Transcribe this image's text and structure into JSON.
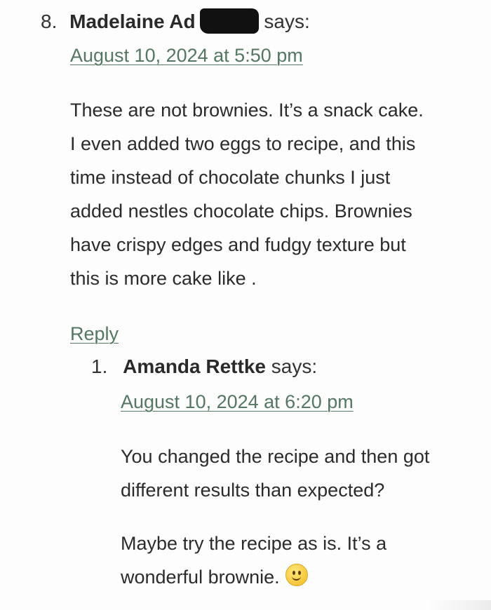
{
  "comment_main": {
    "number": "8.",
    "author": "Madelaine Ad",
    "says": "says:",
    "date": "August 10, 2024 at 5:50 pm",
    "body_lines": [
      "These are not brownies. It’s a snack cake.",
      "I even added two eggs to recipe, and this",
      "time instead of chocolate chunks I just",
      "added nestles chocolate chips. Brownies",
      "have crispy edges and fudgy texture but",
      "this is more cake like ."
    ],
    "reply_label": "Reply"
  },
  "comment_reply": {
    "number": "1.",
    "author": "Amanda Rettke",
    "says": "says:",
    "date": "August 10, 2024 at 6:20 pm",
    "paragraph1_lines": [
      "You changed the recipe and then got",
      "different results than expected?"
    ],
    "paragraph2_lines": [
      "Maybe try the recipe as is. It’s a",
      "wonderful brownie."
    ],
    "emoji_icon": "slightly-smiling-face-icon"
  },
  "colors": {
    "link": "#547763",
    "text": "#2b2b2b",
    "background": "#fdfdfd"
  }
}
